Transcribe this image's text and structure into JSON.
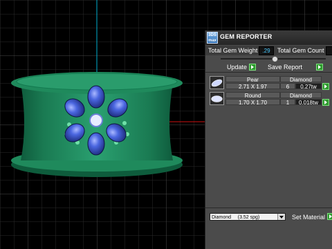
{
  "panel": {
    "title": "GEM REPORTER",
    "app_icon_text": "3DS\nmax",
    "total_gem_weight_label": "Total Gem Weight",
    "total_gem_weight_value": ".29",
    "total_gem_count_label": "Total Gem Count",
    "update_label": "Update",
    "save_report_label": "Save Report",
    "gems": [
      {
        "shape": "Pear",
        "material": "Diamond",
        "size": "2.71 X 1.97",
        "count": "6",
        "weight": "0.27tw"
      },
      {
        "shape": "Round",
        "material": "Diamond",
        "size": "1.70 X 1.70",
        "count": "1",
        "weight": "0.018tw"
      }
    ],
    "material_select_value": "Diamond     (3.52 spg)",
    "set_material_label": "Set Material"
  },
  "colors": {
    "ring": "#1f8a5c",
    "gem": "#3b5fe0",
    "panel_bg": "#4b4b4b",
    "accent_blue": "#49c9ff",
    "go_green": "#2e9a2e"
  }
}
